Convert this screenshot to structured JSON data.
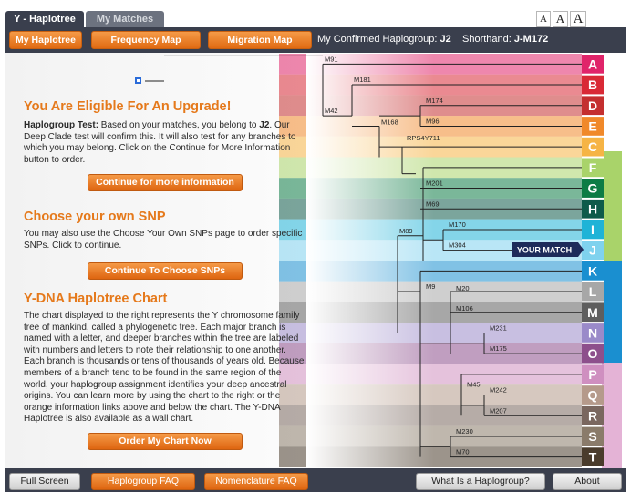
{
  "tabs": [
    {
      "label": "Y - Haplotree",
      "active": true
    },
    {
      "label": "My Matches",
      "active": false
    }
  ],
  "font_size_buttons": [
    "A",
    "A",
    "A"
  ],
  "nav": {
    "my_haplotree": "My Haplotree",
    "frequency_map": "Frequency Map",
    "migration_map": "Migration Map",
    "confirmed_label": "My Confirmed Haplogroup:",
    "confirmed_value": "J2",
    "shorthand_label": "Shorthand:",
    "shorthand_value": "J-M172"
  },
  "upgrade": {
    "heading": "You Are Eligible For An Upgrade!",
    "line1_prefix": "Haplogroup Test:",
    "line1_text": " Based on your matches, you belong to ",
    "line1_value": "J2",
    "line1_tail": ". Our",
    "line2": "Deep Clade test will confirm this. It will also test for any branches to",
    "line3": "which you may belong. Click on the Continue for More Information",
    "line4": "button to order.",
    "button": "Continue for more information"
  },
  "snp": {
    "heading": "Choose your own SNP",
    "line1": "You may also use the Choose Your Own SNPs page to order specific",
    "line2": "SNPs. Click to continue.",
    "button": "Continue To Choose SNPs"
  },
  "chart_info": {
    "heading": "Y-DNA Haplotree Chart",
    "lines": [
      "The chart displayed to the right represents the Y chromosome family",
      "tree of mankind, called a phylogenetic tree. Each major branch is",
      "named with a letter, and deeper branches within the tree are labeled",
      "with numbers and letters to note their relationship to one another.",
      "Each branch is thousands or tens of thousands of years old. Because",
      "members of a branch tend to be found in the same region of the",
      "world, your haplogroup assignment identifies your deep ancestral",
      "origins. You can learn more by using the chart to the right or the",
      "orange information links above and below the chart. The Y-DNA",
      "Haplotree is also available as a wall chart."
    ],
    "button": "Order My Chart Now"
  },
  "tree": {
    "your_match_label": "YOUR MATCH",
    "snp_labels": [
      "M91",
      "M181",
      "M42",
      "M174",
      "M168",
      "M96",
      "RPS4Y711",
      "M201",
      "M69",
      "M89",
      "M170",
      "M304",
      "M9",
      "M20",
      "M106",
      "M231",
      "M175",
      "M45",
      "M242",
      "M207",
      "M230",
      "M70"
    ],
    "haplogroups": [
      {
        "letter": "A",
        "color": "#e0246a"
      },
      {
        "letter": "B",
        "color": "#d92a36"
      },
      {
        "letter": "D",
        "color": "#c42f2f"
      },
      {
        "letter": "E",
        "color": "#f0892a"
      },
      {
        "letter": "C",
        "color": "#f6b445"
      },
      {
        "letter": "F",
        "color": "#a9d36a"
      },
      {
        "letter": "G",
        "color": "#0c7c45"
      },
      {
        "letter": "H",
        "color": "#0e5b4a"
      },
      {
        "letter": "I",
        "color": "#1fb3d7"
      },
      {
        "letter": "J",
        "color": "#7fd2ee"
      },
      {
        "letter": "K",
        "color": "#1a8fd0"
      },
      {
        "letter": "L",
        "color": "#a7a7a7"
      },
      {
        "letter": "M",
        "color": "#5e5e5e"
      },
      {
        "letter": "N",
        "color": "#9a8ac9"
      },
      {
        "letter": "O",
        "color": "#8d4f8c"
      },
      {
        "letter": "P",
        "color": "#cf8fc0"
      },
      {
        "letter": "Q",
        "color": "#b59a8b"
      },
      {
        "letter": "R",
        "color": "#7a675f"
      },
      {
        "letter": "S",
        "color": "#8a7b6a"
      },
      {
        "letter": "T",
        "color": "#4a3c2c"
      }
    ]
  },
  "bottom": {
    "full_screen": "Full Screen",
    "haplogroup_faq": "Haplogroup FAQ",
    "nomenclature_faq": "Nomenclature FAQ",
    "what_is": "What Is a Haplogroup?",
    "about": "About"
  }
}
